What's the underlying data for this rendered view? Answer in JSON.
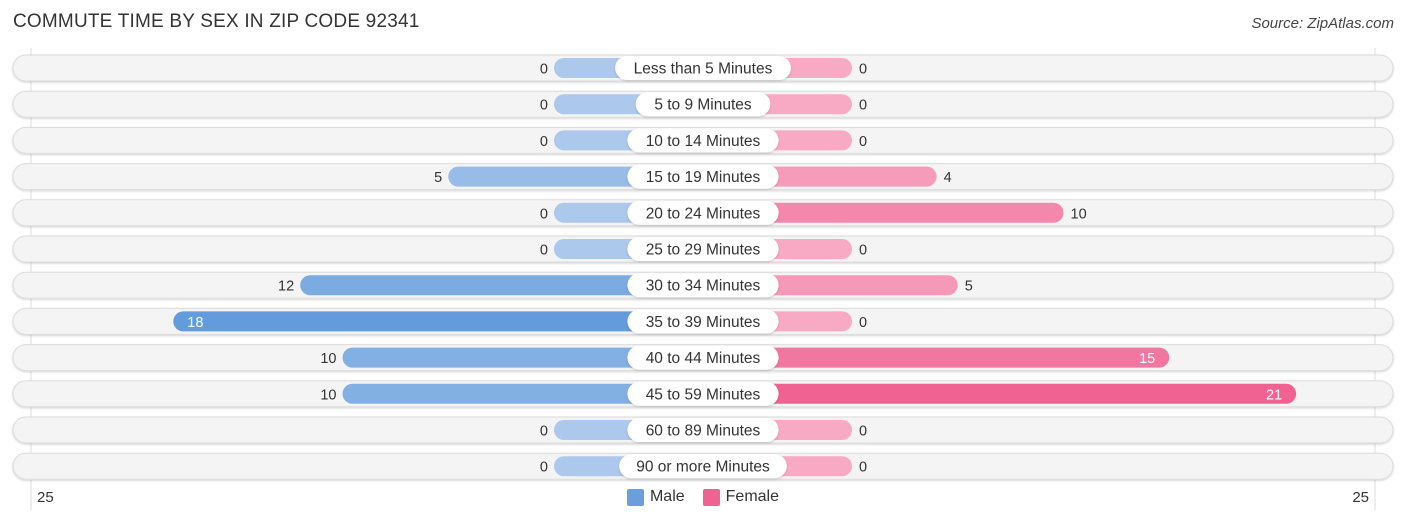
{
  "title": "COMMUTE TIME BY SEX IN ZIP CODE 92341",
  "source": "Source: ZipAtlas.com",
  "chart_data": {
    "type": "bar",
    "orientation": "horizontal-diverging",
    "title": "COMMUTE TIME BY SEX IN ZIP CODE 92341",
    "categories": [
      "Less than 5 Minutes",
      "5 to 9 Minutes",
      "10 to 14 Minutes",
      "15 to 19 Minutes",
      "20 to 24 Minutes",
      "25 to 29 Minutes",
      "30 to 34 Minutes",
      "35 to 39 Minutes",
      "40 to 44 Minutes",
      "45 to 59 Minutes",
      "60 to 89 Minutes",
      "90 or more Minutes"
    ],
    "series": [
      {
        "name": "Male",
        "color": "#6a9fdb",
        "values": [
          0,
          0,
          0,
          5,
          0,
          0,
          12,
          18,
          10,
          10,
          0,
          0
        ]
      },
      {
        "name": "Female",
        "color": "#f06292",
        "values": [
          0,
          0,
          0,
          4,
          10,
          0,
          5,
          0,
          15,
          21,
          0,
          0
        ]
      }
    ],
    "axis_min_label": "25",
    "axis_max_label": "25",
    "xlim": [
      -25,
      25
    ],
    "legend": "bottom-center"
  },
  "legend": {
    "male": "Male",
    "female": "Female"
  },
  "axis": {
    "left": "25",
    "right": "25"
  }
}
